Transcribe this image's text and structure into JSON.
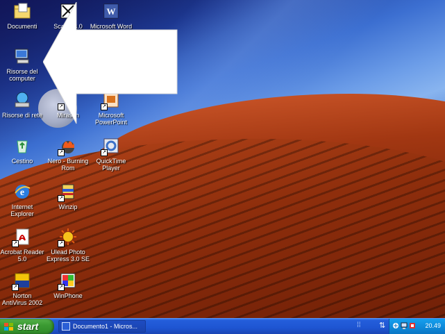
{
  "desktop": {
    "icons": [
      {
        "label": "Documenti",
        "icon": "folder-icon"
      },
      {
        "label": "Risorse del\ncomputer",
        "icon": "computer-icon"
      },
      {
        "label": "Risorse di rete",
        "icon": "network-icon"
      },
      {
        "label": "Cestino",
        "icon": "recycle-bin-icon"
      },
      {
        "label": "Internet\nExplorer",
        "icon": "ie-icon"
      },
      {
        "label": "Acrobat Reader\n5.0",
        "icon": "acrobat-icon"
      },
      {
        "label": "Norton\nAntiVirus 2002",
        "icon": "norton-icon"
      },
      {
        "label": "ScanB 3.0",
        "icon": "scanner-icon"
      },
      {
        "label": "Mirasun",
        "icon": "mirasun-icon"
      },
      {
        "label": "Nero - Burning\nRom",
        "icon": "nero-icon"
      },
      {
        "label": "Winzip",
        "icon": "winzip-icon"
      },
      {
        "label": "Ulead Photo\nExpress 3.0 SE",
        "icon": "ulead-icon"
      },
      {
        "label": "WinPhone",
        "icon": "winphone-icon"
      },
      {
        "label": "Microsoft Word",
        "icon": "word-icon"
      },
      {
        "label": "Microsoft\nPowerPoint",
        "icon": "powerpoint-icon"
      },
      {
        "label": "QuickTime\nPlayer",
        "icon": "quicktime-icon"
      }
    ]
  },
  "taskbar": {
    "start_label": "start",
    "task_label": "Documento1 - Micros...",
    "clock": "20.49",
    "colors": {
      "taskbar": "#245edb",
      "start": "#3c9b33",
      "tray": "#0f8cdc"
    }
  }
}
